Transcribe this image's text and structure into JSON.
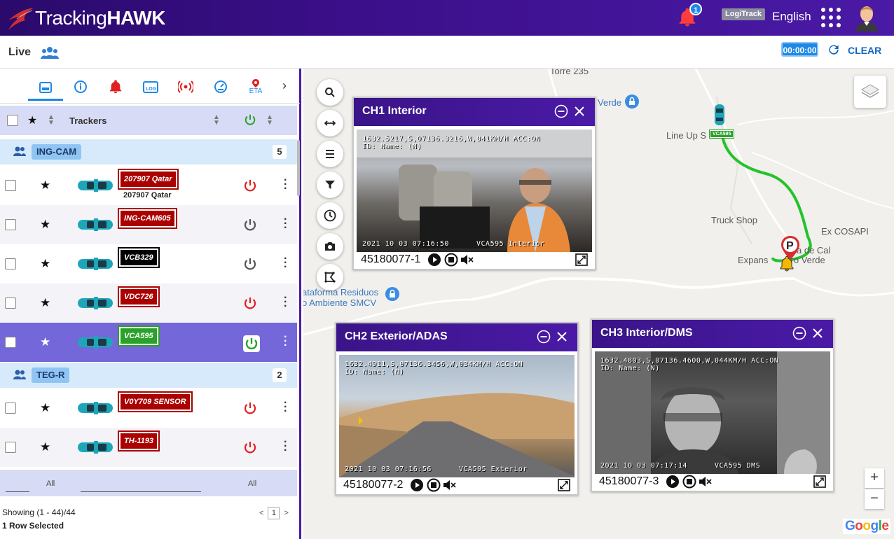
{
  "header": {
    "brand_light": "Tracking",
    "brand_bold": "HAWK",
    "notification_count": "1",
    "logitrack_label": "LogiTrack",
    "language": "English"
  },
  "subheader": {
    "title": "Live",
    "timer": "00:00:00",
    "clear_label": "CLEAR"
  },
  "tabs": [
    "vehicle-card",
    "info",
    "alarm",
    "log",
    "signal",
    "dashboard",
    "ETA"
  ],
  "tab_eta_label": "ETA",
  "table": {
    "column_trackers": "Trackers"
  },
  "groups": [
    {
      "name": "ING-CAM",
      "count": "5"
    },
    {
      "name": "TEG-R",
      "count": "2"
    }
  ],
  "vehicles": [
    {
      "plate": "207907 Qatar",
      "sub": "207907 Qatar",
      "power": "on",
      "plate_color": "#a00000"
    },
    {
      "plate": "ING-CAM605",
      "sub": "",
      "power": "off",
      "plate_color": "#a00000"
    },
    {
      "plate": "VCB329",
      "sub": "",
      "power": "off",
      "plate_color": "#000000"
    },
    {
      "plate": "VDC726",
      "sub": "",
      "power": "on",
      "plate_color": "#a00000"
    },
    {
      "plate": "VCA595",
      "sub": "",
      "power": "active",
      "plate_color": "#2aa12a"
    },
    {
      "plate": "V0Y709 SENSOR",
      "sub": "",
      "power": "on",
      "plate_color": "#a00000"
    },
    {
      "plate": "TH-1193",
      "sub": "",
      "power": "on",
      "plate_color": "#a00000"
    }
  ],
  "footer": {
    "filter_all_1": "All",
    "filter_all_2": "All",
    "showing": "Showing (1 - 44)/44",
    "selected": "1 Row Selected",
    "page": "1",
    "prev": "<",
    "next": ">"
  },
  "map": {
    "labels": [
      "Torre 235",
      "Verde",
      "Line Up S",
      "Truck Shop",
      "Ex COSAPI",
      "Expans",
      "erro Verde",
      "a de Cal",
      "ataforma Residuos",
      "o Ambiente SMCV"
    ],
    "vehicle_tag": "VCA595",
    "zoom_in": "+",
    "zoom_out": "−",
    "google": "Google"
  },
  "cameras": [
    {
      "title": "CH1 Interior",
      "device_id": "45180077-1",
      "osd_top": "1632.5217,S,07136.3216,W,041KM/H ACC:ON\nID: Name: (N)",
      "osd_bottom": "2021 10 03 07:16:50      VCA595 Interior"
    },
    {
      "title": "CH2 Exterior/ADAS",
      "device_id": "45180077-2",
      "osd_top": "1632.4911,S,07136.3456,W,034KM/H ACC:ON\nID: Name: (N)",
      "osd_bottom": "2021 10 03 07:16:56      VCA595 Exterior"
    },
    {
      "title": "CH3 Interior/DMS",
      "device_id": "45180077-3",
      "osd_top": "1632.4803,S,07136.4600,W,044KM/H ACC:ON\nID: Name: (N)",
      "osd_bottom": "2021 10 03 07:17:14      VCA595 DMS"
    }
  ]
}
